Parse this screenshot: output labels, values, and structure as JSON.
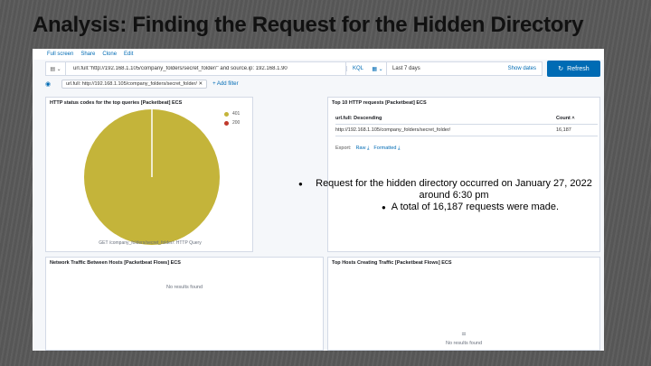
{
  "slide": {
    "title": "Analysis: Finding the Request for the Hidden Directory"
  },
  "topbar": {
    "items": [
      "Full screen",
      "Share",
      "Clone",
      "Edit"
    ]
  },
  "query": {
    "text": "url.full:\"http://192.168.1.105/company_folders/secret_folder/\" and source.ip: 192.168.1.90",
    "language": "KQL"
  },
  "date": {
    "range": "Last 7 days",
    "show_dates": "Show dates"
  },
  "refresh": {
    "label": "Refresh"
  },
  "filter": {
    "pill": "url.full: http://192.168.1.105/company_folders/secret_folder/",
    "add": "+ Add filter"
  },
  "panels": {
    "status_codes": {
      "title": "HTTP status codes for the top queries [Packetbeat] ECS",
      "legend": [
        {
          "label": "401",
          "color": "#c4b43a"
        },
        {
          "label": "200",
          "color": "#c0392b"
        }
      ],
      "caption": "GET /company_folders/secret_folder/: HTTP Query"
    },
    "top_requests": {
      "title": "Top 10 HTTP requests [Packetbeat] ECS",
      "col_url": "url.full: Descending",
      "col_count": "Count",
      "row_url": "http://192.168.1.105/company_folders/secret_folder/",
      "row_count": "16,187",
      "export_label": "Export:",
      "raw": "Raw",
      "formatted": "Formatted"
    },
    "network_traffic": {
      "title": "Network Traffic Between Hosts [Packetbeat Flows] ECS",
      "empty": "No results found"
    },
    "top_hosts": {
      "title": "Top Hosts Creating Traffic [Packetbeat Flows] ECS",
      "empty": "No results found"
    }
  },
  "notes": {
    "b1": "Request for the hidden directory occurred on January 27, 2022 around 6:30 pm",
    "b2": "A total of 16,187 requests were made."
  }
}
